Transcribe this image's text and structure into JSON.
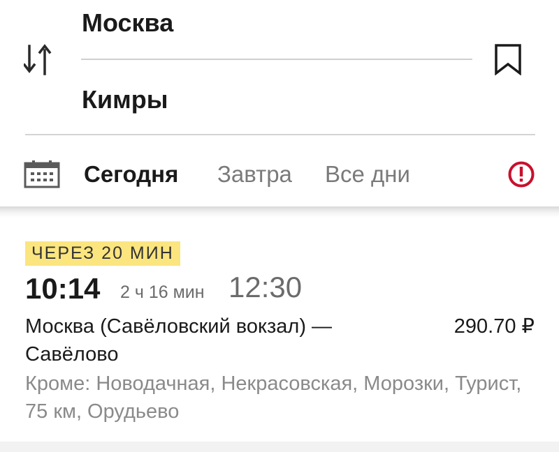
{
  "route": {
    "from": "Москва",
    "to": "Кимры"
  },
  "date_tabs": {
    "today": "Сегодня",
    "tomorrow": "Завтра",
    "all_days": "Все дни"
  },
  "trip": {
    "badge": "ЧЕРЕЗ 20 МИН",
    "departure": "10:14",
    "duration": "2 ч 16 мин",
    "arrival": "12:30",
    "train_name": "Москва (Савёловский вокзал) — Савёлово",
    "price": "290.70 ₽",
    "excluding_stops": "Кроме: Новодачная, Некрасовская, Морозки, Турист, 75 км, Орудьево"
  },
  "colors": {
    "badge_bg": "#fbe57f",
    "alert": "#c8102e",
    "muted_text": "#7a7a7a"
  },
  "icons": {
    "swap": "swap-vertical-arrows",
    "bookmark": "bookmark-outline",
    "calendar": "calendar",
    "alert": "exclamation-circle"
  }
}
